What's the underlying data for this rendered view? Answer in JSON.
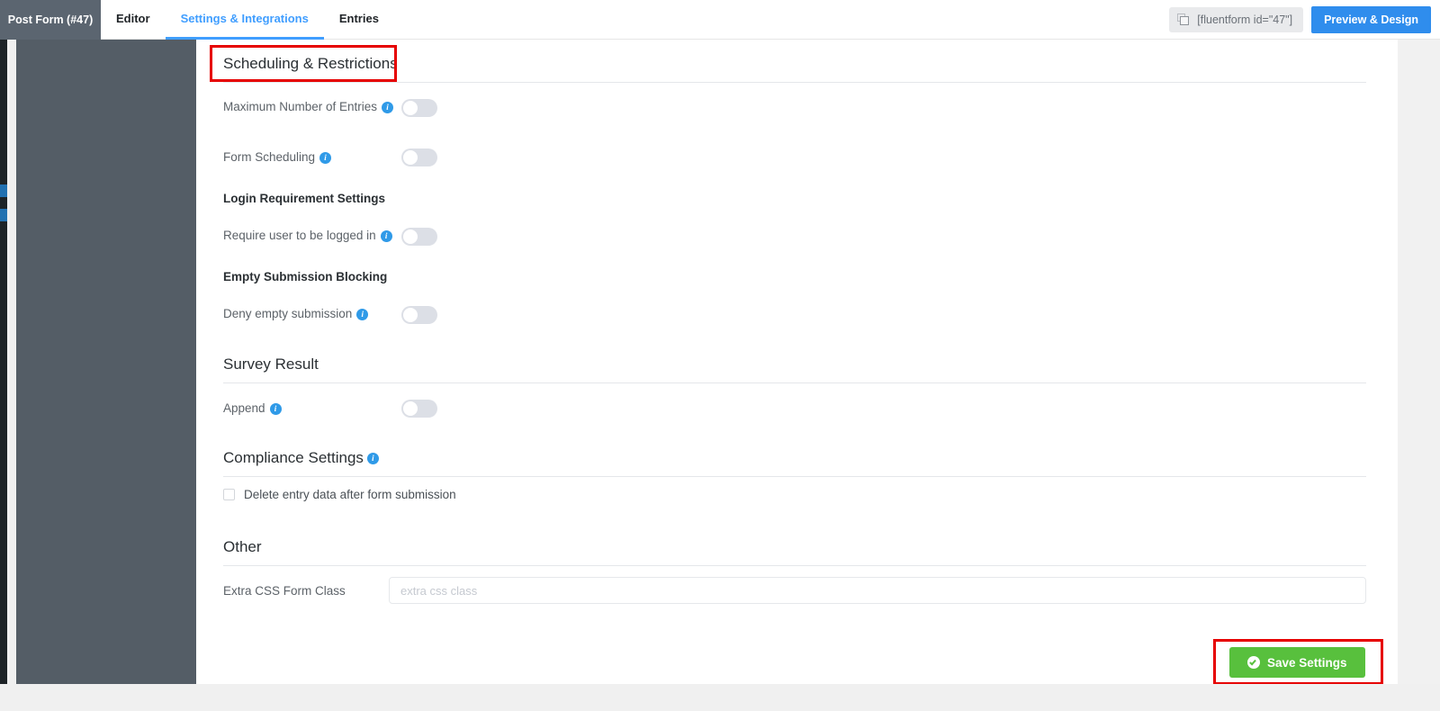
{
  "topbar": {
    "form_title": "Post Form (#47)",
    "tabs": [
      {
        "label": "Editor",
        "active": false
      },
      {
        "label": "Settings & Integrations",
        "active": true
      },
      {
        "label": "Entries",
        "active": false
      }
    ],
    "shortcode": "[fluentform id=\"47\"]",
    "shortcode_icon": "copy-icon",
    "preview_button": "Preview & Design"
  },
  "sections": {
    "scheduling": {
      "title": "Scheduling & Restrictions",
      "rows": [
        {
          "label": "Maximum Number of Entries",
          "info": true,
          "toggle": "off"
        },
        {
          "label": "Form Scheduling",
          "info": true,
          "toggle": "off"
        }
      ],
      "login_subhead": "Login Requirement Settings",
      "login_row": {
        "label": "Require user to be logged in",
        "info": true,
        "toggle": "off"
      },
      "empty_subhead": "Empty Submission Blocking",
      "empty_row": {
        "label": "Deny empty submission",
        "info": true,
        "toggle": "off"
      }
    },
    "survey": {
      "title": "Survey Result",
      "row": {
        "label": "Append",
        "info": true,
        "toggle": "off"
      }
    },
    "compliance": {
      "title": "Compliance Settings",
      "info": true,
      "checkbox_label": "Delete entry data after form submission",
      "checkbox_checked": false
    },
    "other": {
      "title": "Other",
      "field_label": "Extra CSS Form Class",
      "field_value": "",
      "field_placeholder": "extra css class"
    }
  },
  "footer": {
    "save_label": "Save Settings",
    "save_icon": "check-circle-icon"
  },
  "colors": {
    "accent_blue": "#409eff",
    "preview_blue": "#2f8ded",
    "save_green": "#58c03d",
    "info_blue": "#2f9ae8",
    "annotation_red": "#e60000",
    "side_panel": "#545d66"
  }
}
